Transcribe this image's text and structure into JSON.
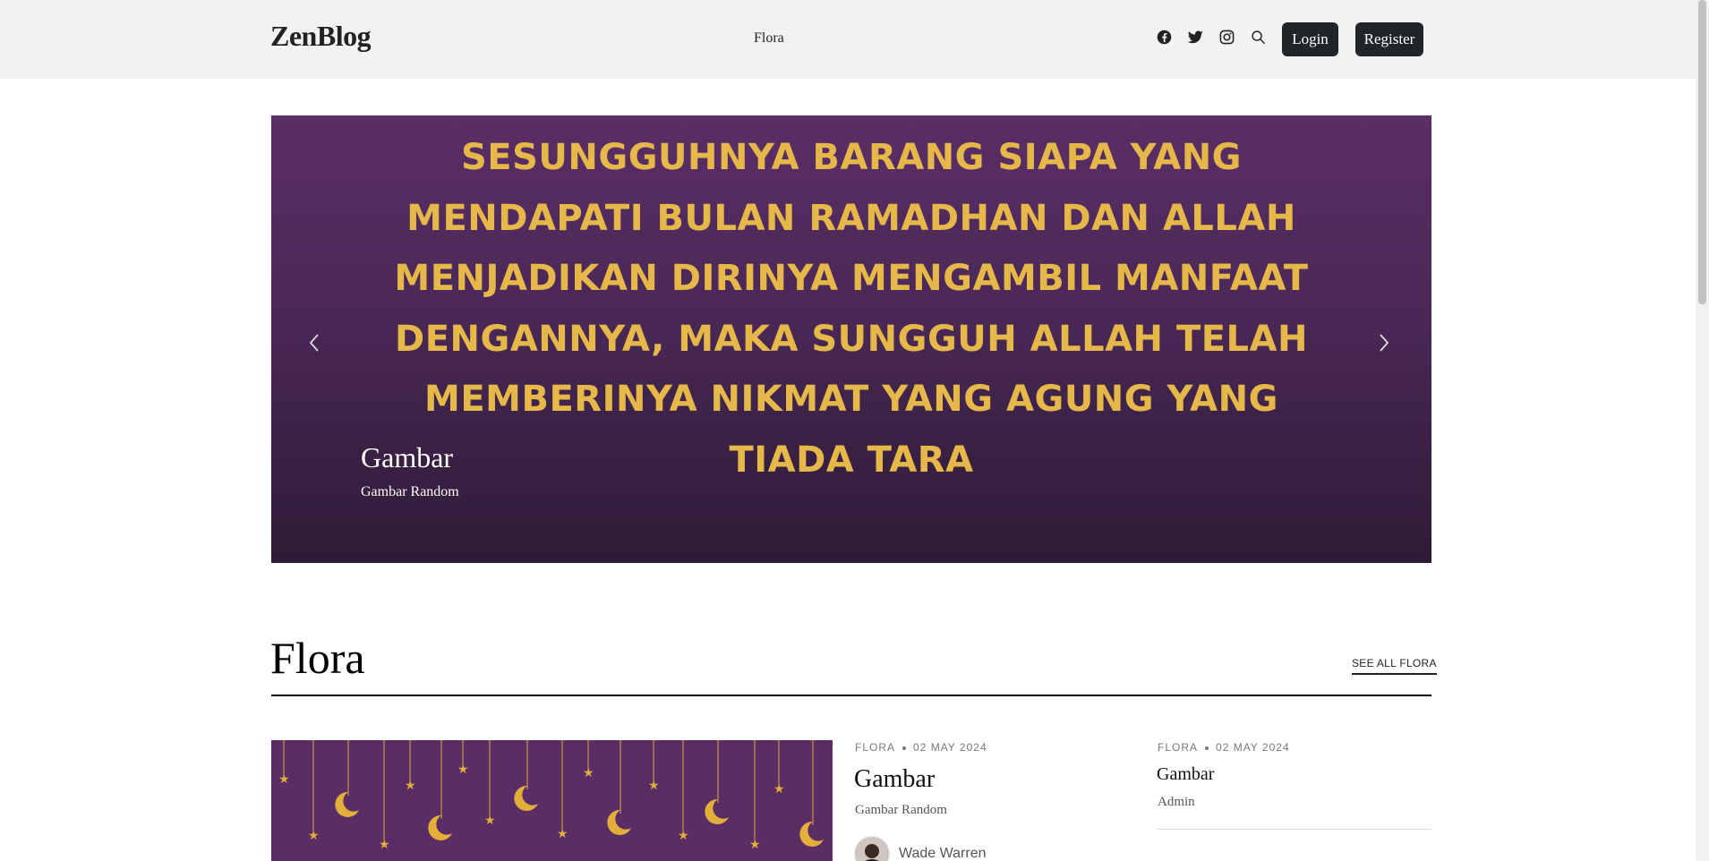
{
  "header": {
    "logo": "ZenBlog",
    "nav": [
      "Flora"
    ],
    "social_icons": [
      "facebook-icon",
      "twitter-icon",
      "instagram-icon",
      "search-icon"
    ],
    "login_label": "Login",
    "register_label": "Register"
  },
  "hero": {
    "quote": "Sesungguhnya barang siapa yang mendapati bulan Ramadhan dan allah menjadikan dirinya mengambil manfaat dengannya, maka sungguh allah telah memberinya nikmat yang agung yang tiada tara",
    "title": "Gambar",
    "subtitle": "Gambar Random",
    "colors": {
      "background": "#4a2856",
      "quote_text": "#e6b84a"
    }
  },
  "section": {
    "title": "Flora",
    "see_all": "SEE ALL FLORA"
  },
  "posts": [
    {
      "category": "Flora",
      "date": "02 May 2024",
      "title": "Gambar",
      "subtitle": "Gambar Random",
      "author": "Wade Warren"
    },
    {
      "category": "Flora",
      "date": "02 May 2024",
      "title": "Gambar",
      "subtitle": "Admin"
    }
  ]
}
